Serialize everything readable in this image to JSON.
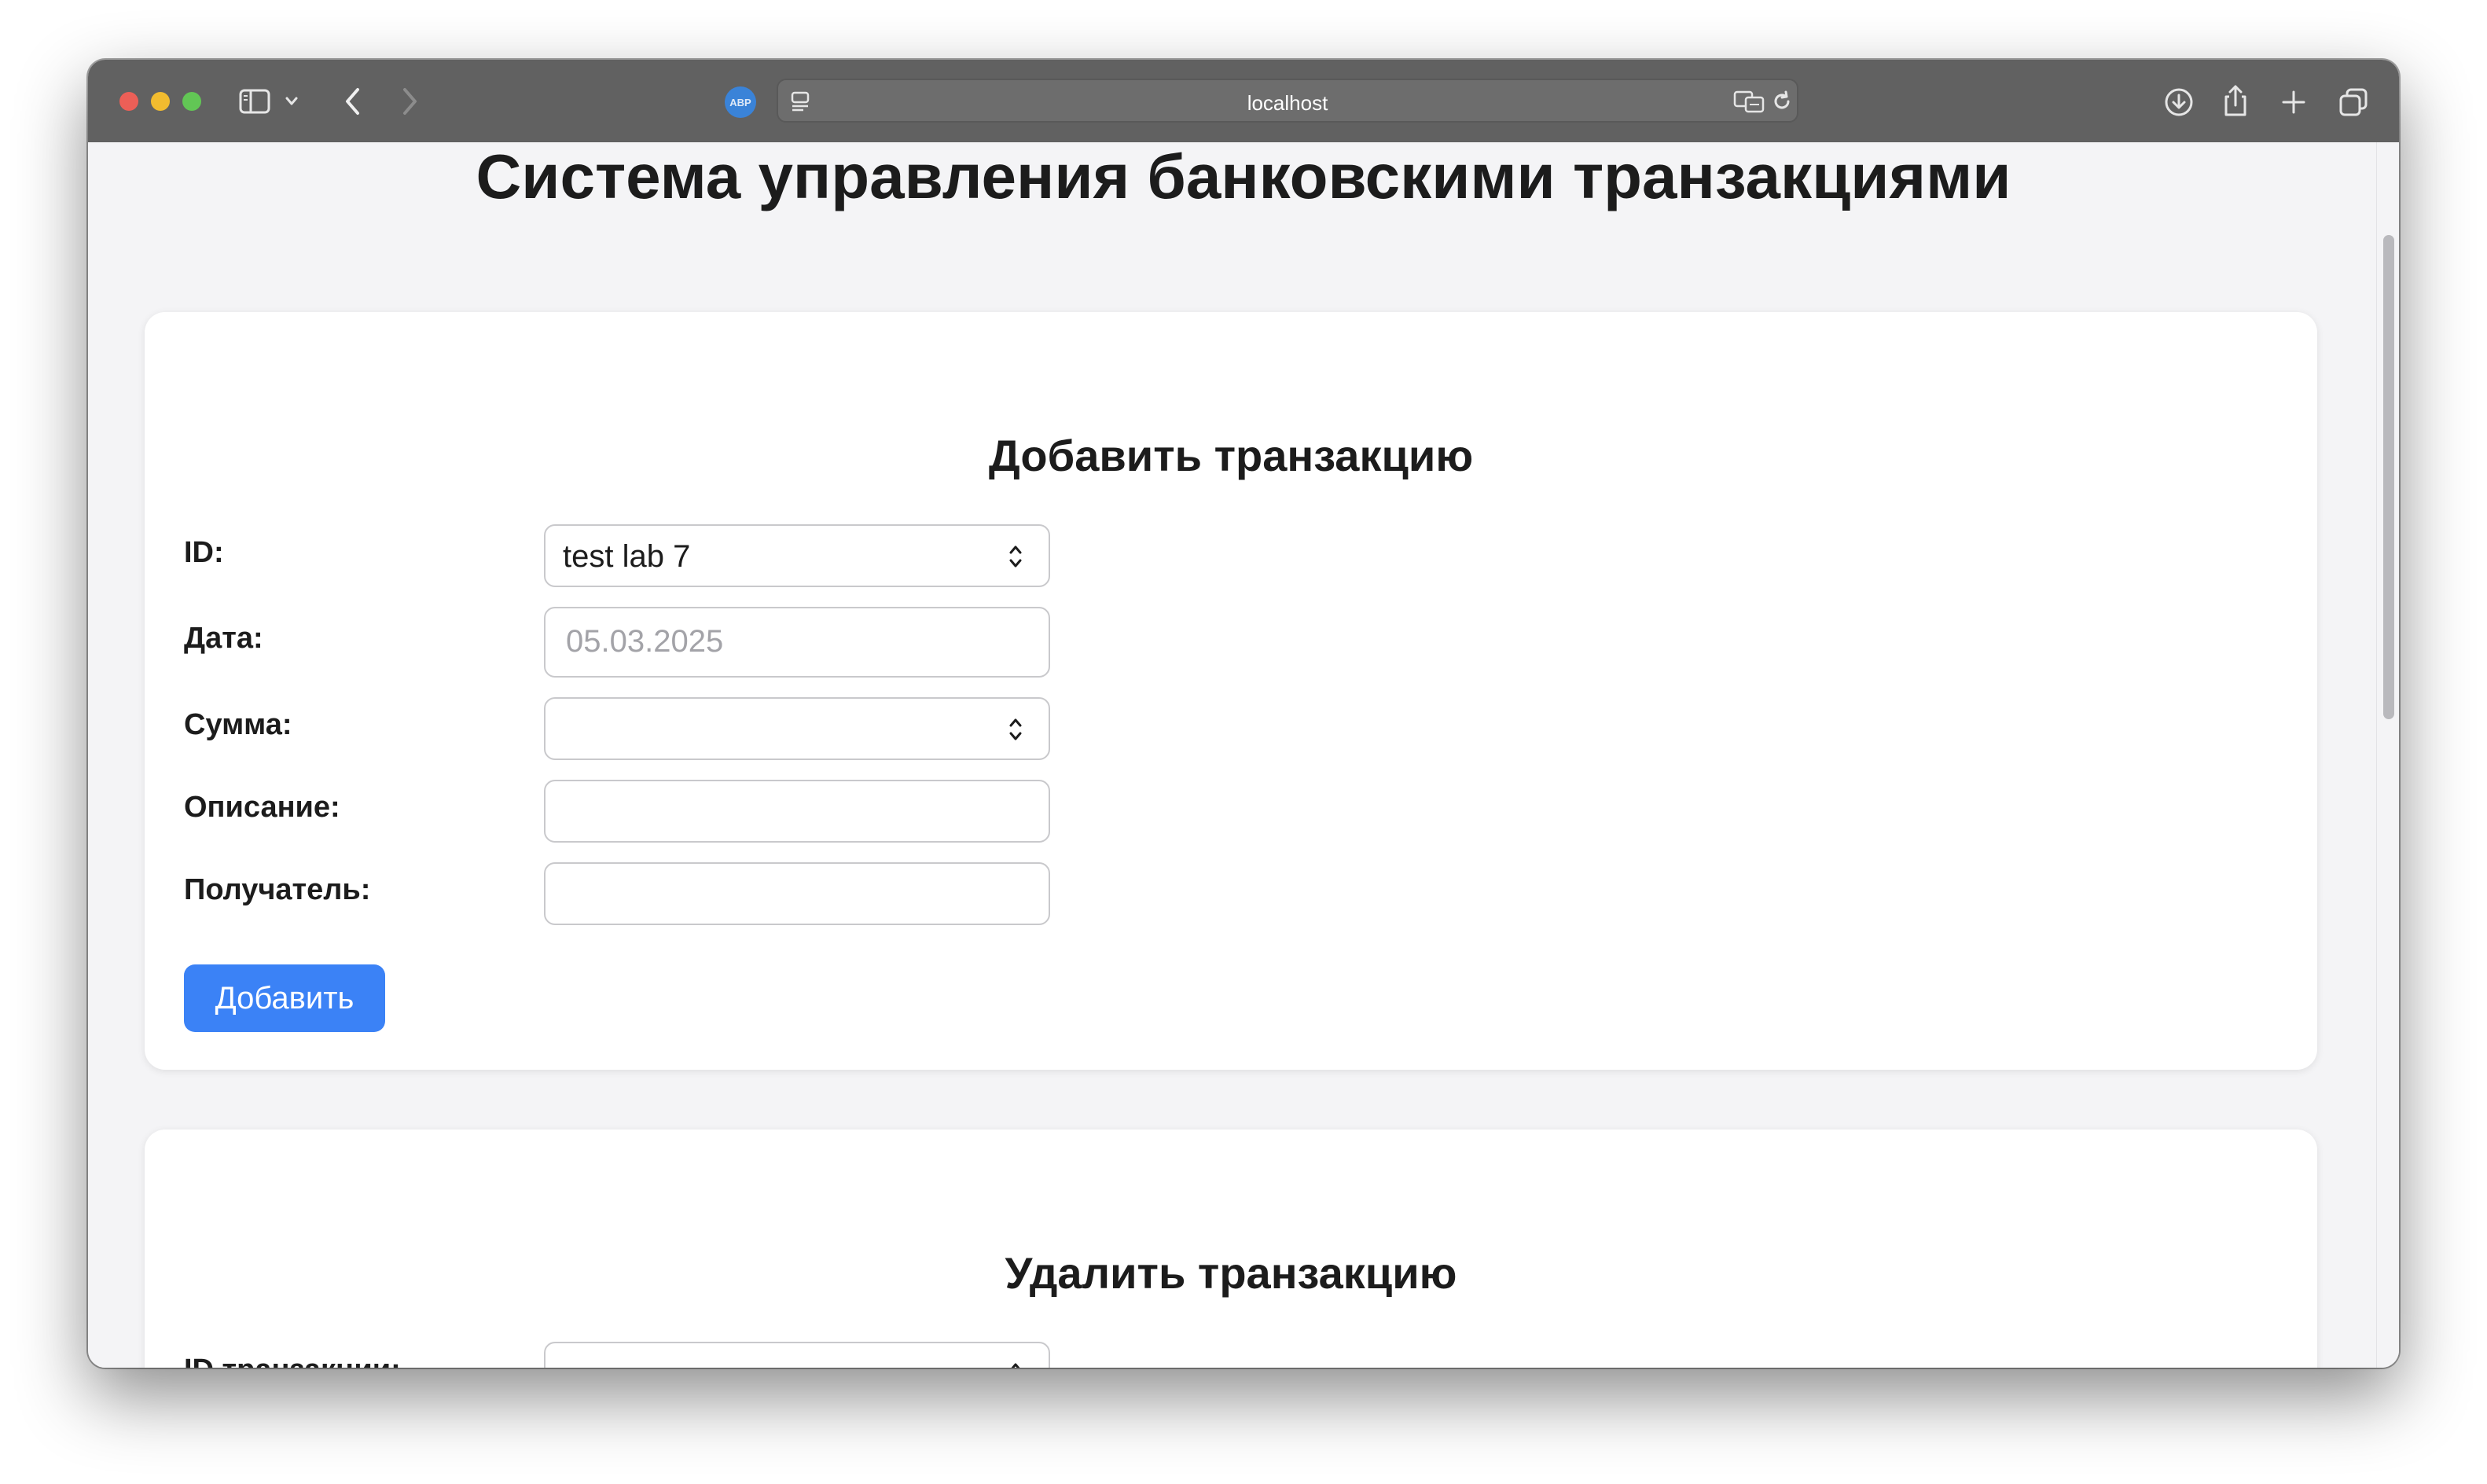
{
  "browser": {
    "url": "localhost",
    "traffic_lights": {
      "close": "#ec5f57",
      "minimize": "#f2bc2f",
      "maximize": "#62c655"
    },
    "icons": {
      "sidebar": "sidebar-icon",
      "chevron": "chevron-down-icon",
      "back": "back-icon",
      "forward": "forward-icon",
      "adblock": "abp-icon",
      "reader": "reader-icon",
      "translate": "translate-icon",
      "reload": "reload-icon",
      "downloads": "download-icon",
      "share": "share-icon",
      "new_tab": "plus-icon",
      "tabs": "tab-overview-icon"
    },
    "abp_label": "ABP"
  },
  "page": {
    "title": "Система управления банковскими транзакциями"
  },
  "add_form": {
    "heading": "Добавить транзакцию",
    "fields": [
      {
        "label": "ID:",
        "value": "test lab 7",
        "placeholder": ""
      },
      {
        "label": "Дата:",
        "value": "",
        "placeholder": "05.03.2025"
      },
      {
        "label": "Сумма:",
        "value": "",
        "placeholder": ""
      },
      {
        "label": "Описание:",
        "value": "",
        "placeholder": ""
      },
      {
        "label": "Получатель:",
        "value": "",
        "placeholder": ""
      }
    ],
    "submit_label": "Добавить",
    "accent_color": "#3b82f6"
  },
  "delete_form": {
    "heading": "Удалить транзакцию",
    "fields": [
      {
        "label": "ID транзакции:",
        "value": "",
        "placeholder": ""
      }
    ]
  }
}
